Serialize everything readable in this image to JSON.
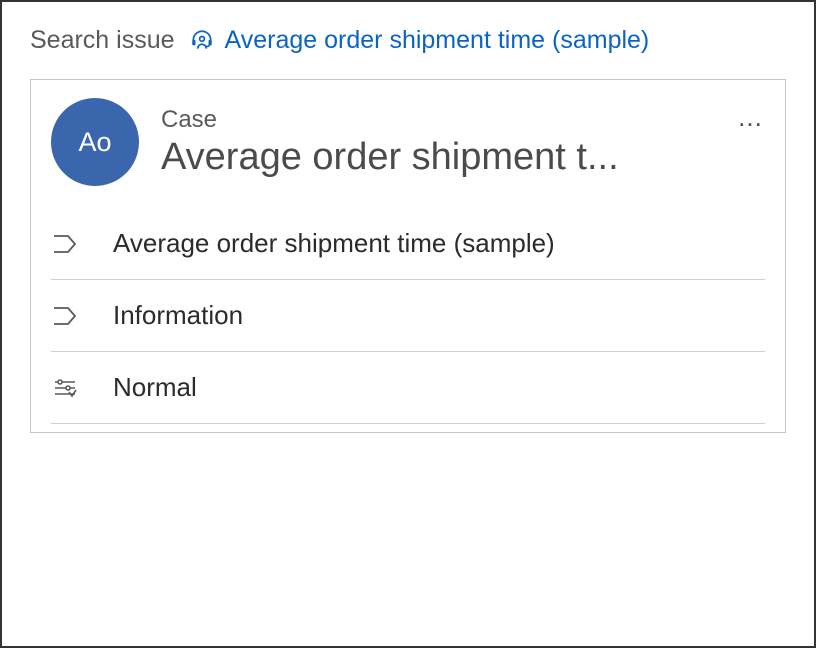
{
  "breadcrumb": {
    "root": "Search issue",
    "link": "Average order shipment time (sample)"
  },
  "card": {
    "avatar_initials": "Ao",
    "type_label": "Case",
    "title": "Average order shipment t..."
  },
  "details": {
    "title": "Average order shipment time (sample)",
    "form": "Information",
    "priority": "Normal"
  }
}
